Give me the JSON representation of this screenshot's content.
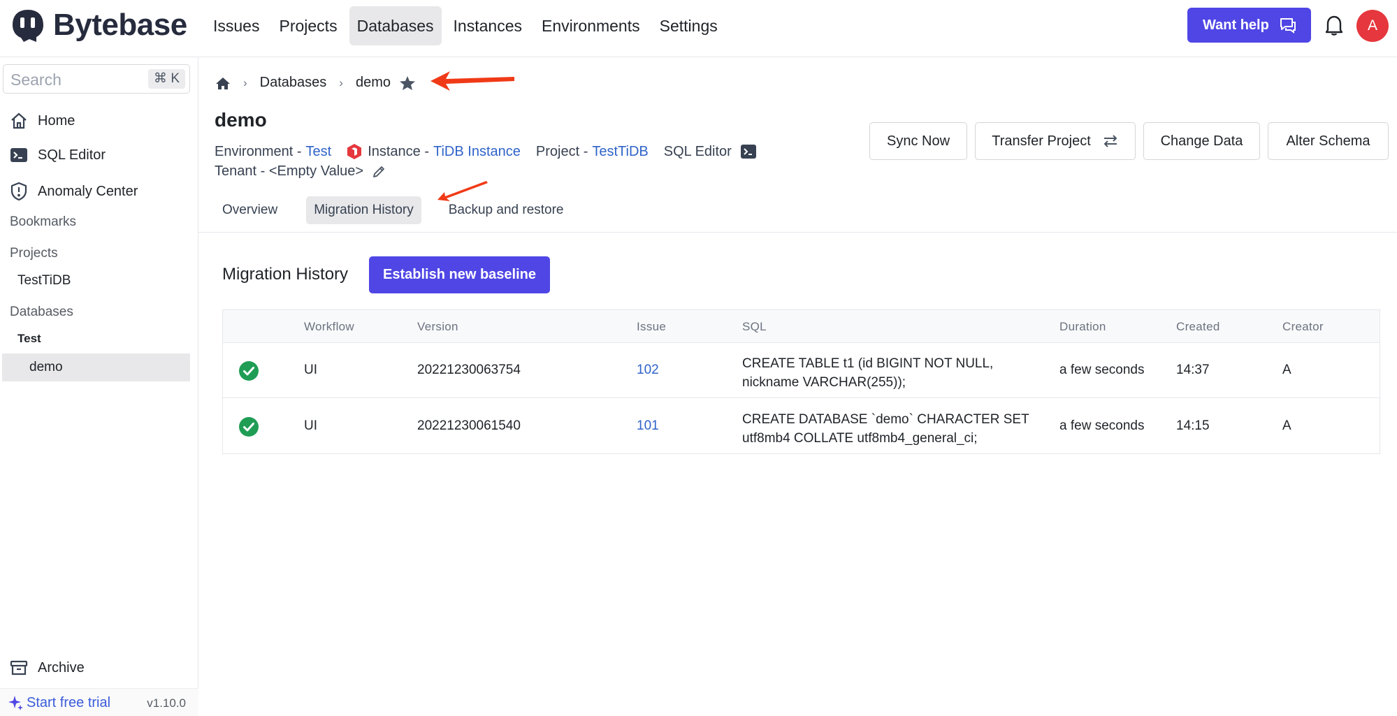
{
  "app": {
    "name": "Bytebase"
  },
  "topnav": {
    "items": [
      "Issues",
      "Projects",
      "Databases",
      "Instances",
      "Environments",
      "Settings"
    ],
    "active": "Databases"
  },
  "header": {
    "want_help": "Want help",
    "avatar_initial": "A"
  },
  "sidebar": {
    "search_placeholder": "Search",
    "search_shortcut": "⌘ K",
    "items": [
      "Home",
      "SQL Editor",
      "Anomaly Center"
    ],
    "bookmarks": "Bookmarks",
    "projects_label": "Projects",
    "project_item": "TestTiDB",
    "databases_label": "Databases",
    "env_label": "Test",
    "db_item": "demo",
    "archive": "Archive",
    "trial": "Start free trial",
    "version": "v1.10.0"
  },
  "breadcrumb": {
    "databases": "Databases",
    "current": "demo"
  },
  "page": {
    "title": "demo",
    "environment_label": "Environment -",
    "environment_value": "Test",
    "instance_label": "Instance -",
    "instance_value": "TiDB Instance",
    "project_label": "Project -",
    "project_value": "TestTiDB",
    "sql_editor": "SQL Editor",
    "tenant": "Tenant - <Empty Value>"
  },
  "actions": {
    "sync_now": "Sync Now",
    "transfer_project": "Transfer Project",
    "change_data": "Change Data",
    "alter_schema": "Alter Schema"
  },
  "tabs": [
    "Overview",
    "Migration History",
    "Backup and restore"
  ],
  "migration": {
    "title": "Migration History",
    "baseline_button": "Establish new baseline",
    "columns": [
      "Workflow",
      "Version",
      "Issue",
      "SQL",
      "Duration",
      "Created",
      "Creator"
    ],
    "rows": [
      {
        "status": "done",
        "workflow": "UI",
        "version": "20221230063754",
        "issue": "102",
        "sql_line1": "CREATE TABLE t1 (id BIGINT NOT NULL,",
        "sql_line2": "nickname VARCHAR(255));",
        "duration": "a few seconds",
        "created": "14:37",
        "creator": "A"
      },
      {
        "status": "done",
        "workflow": "UI",
        "version": "20221230061540",
        "issue": "101",
        "sql_line1": "CREATE DATABASE `demo` CHARACTER SET",
        "sql_line2": "utf8mb4 COLLATE utf8mb4_general_ci;",
        "duration": "a few seconds",
        "created": "14:15",
        "creator": "A"
      }
    ]
  },
  "colors": {
    "accent": "#4f46e5",
    "link": "#2f63c8",
    "success": "#1f9d55",
    "avatar": "#e5373d",
    "annotation_arrow": "#f03a17"
  }
}
